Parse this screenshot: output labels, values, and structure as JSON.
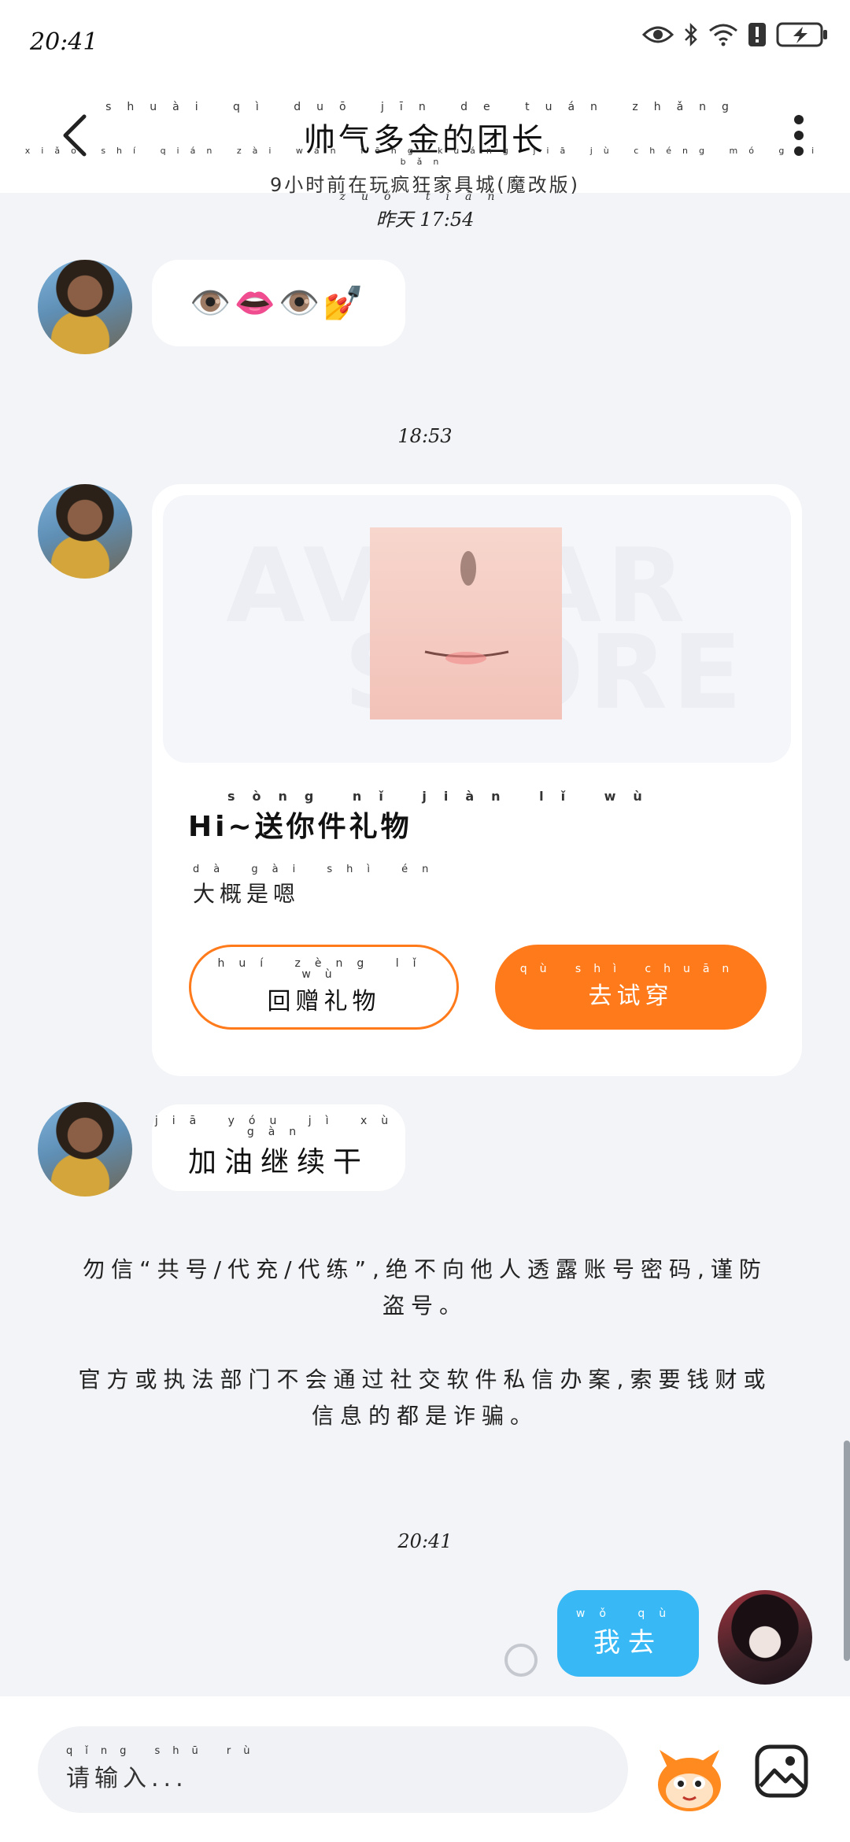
{
  "status": {
    "time": "20:41",
    "icons": [
      "eye-icon",
      "bluetooth-icon",
      "wifi-icon",
      "alert-icon",
      "battery-charging-icon"
    ]
  },
  "header": {
    "title": "帅气多金的团长",
    "title_pinyin": "shuài qì duō jīn de tuán zhǎng",
    "subtitle": "9小时前在玩疯狂家具城(魔改版)",
    "subtitle_pinyin": "xiǎo shí qián zài wán fēng kuáng jiā jù chéng mó gǎi bǎn"
  },
  "messages": {
    "ts1": "昨天 17:54",
    "ts1_pinyin": "zuó tiān",
    "emoji_msg": "👁️👄👁️💅",
    "ts2": "18:53",
    "gift": {
      "title": "Hi~送你件礼物",
      "title_pinyin": "sòng nǐ jiàn lǐ wù",
      "desc": "大概是嗯",
      "desc_pinyin": "dà gài shì én",
      "btn_return": "回赠礼物",
      "btn_return_pinyin": "huí zèng lǐ wù",
      "btn_try": "去试穿",
      "btn_try_pinyin": "qù shì chuān",
      "watermark_line1": "AVATAR",
      "watermark_line2": "STORE"
    },
    "text_msg": "加油继续干",
    "text_msg_pinyin": "jiā yóu jì xù gàn",
    "notice1": "勿信“共号/代充/代练”,绝不向他人透露账号密码,谨防盗号。",
    "notice2": "官方或执法部门不会通过社交软件私信办案,索要钱财或信息的都是诈骗。",
    "ts3": "20:41",
    "my_msg": "我去",
    "my_msg_pinyin": "wǒ qù"
  },
  "input": {
    "placeholder": "请输入...",
    "placeholder_pinyin": "qǐng shū rù"
  },
  "colors": {
    "accent_orange": "#ff7a1a",
    "my_bubble_blue": "#38b9f5",
    "background": "#f3f4f7"
  }
}
